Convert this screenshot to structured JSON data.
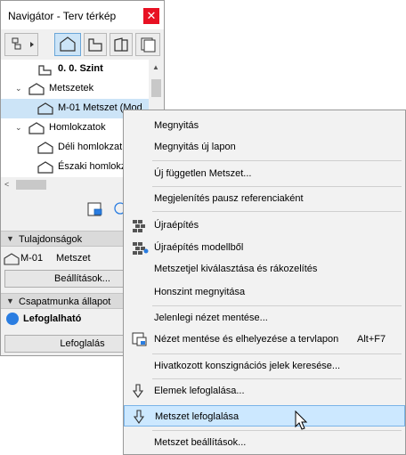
{
  "navigator": {
    "title": "Navigátor - Terv térkép",
    "close_glyph": "✕",
    "toolbar": {
      "buttons": [
        {
          "icon": "view-switch-icon"
        },
        {
          "icon": "project-map-icon"
        },
        {
          "icon": "view-map-icon"
        },
        {
          "icon": "layout-book-icon"
        },
        {
          "icon": "publisher-icon"
        }
      ]
    },
    "tree": {
      "items": [
        {
          "label": "0. 0. Szint",
          "icon": "story-icon"
        },
        {
          "label": "Metszetek",
          "icon": "sections-folder-icon",
          "expander": "⌄"
        },
        {
          "label": "M-01 Metszet (Mod",
          "icon": "section-icon"
        },
        {
          "label": "Homlokzatok",
          "icon": "elevations-folder-icon",
          "expander": "⌄"
        },
        {
          "label": "Déli homlokzat",
          "icon": "elevation-icon"
        },
        {
          "label": "Északi homlokz",
          "icon": "elevation-icon"
        }
      ]
    },
    "properties": {
      "header": "Tulajdonságok",
      "id": "M-01",
      "name": "Metszet",
      "settings_button": "Beállítások..."
    },
    "teamwork": {
      "header": "Csapatmunka állapot",
      "status": "Lefoglalható",
      "status_color": "#2a7de1",
      "reserve_button": "Lefoglalás"
    }
  },
  "context_menu": {
    "items": [
      {
        "label": "Megnyitás"
      },
      {
        "label": "Megnyitás új lapon"
      },
      {
        "label": "Új független Metszet..."
      },
      {
        "label": "Megjelenítés pausz referenciaként"
      },
      {
        "label": "Újraépítés",
        "icon": "rebuild-icon"
      },
      {
        "label": "Újraépítés modellből",
        "icon": "rebuild-from-model-icon"
      },
      {
        "label": "Metszetjel kiválasztása és rákozelítés"
      },
      {
        "label": "Honszint megnyitása"
      },
      {
        "label": "Jelenlegi nézet mentése..."
      },
      {
        "label": "Nézet mentése és elhelyezése a tervlapon",
        "shortcut": "Alt+F7",
        "icon": "save-place-view-icon"
      },
      {
        "label": "Hivatkozott konszignációs jelek keresése..."
      },
      {
        "label": "Elemek lefoglalása...",
        "icon": "reserve-arrow-icon"
      },
      {
        "label": "Metszet lefoglalása",
        "icon": "reserve-arrow-icon",
        "highlighted": true
      },
      {
        "label": "Metszet beállítások..."
      }
    ],
    "highlight_color": "#cce8ff"
  }
}
